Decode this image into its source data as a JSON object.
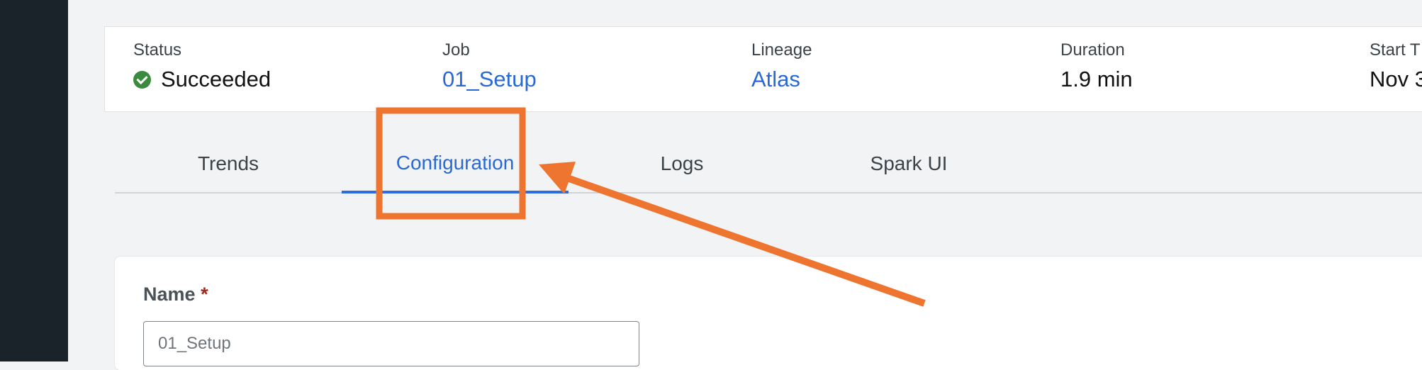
{
  "summary": {
    "status": {
      "label": "Status",
      "value": "Succeeded"
    },
    "job": {
      "label": "Job",
      "value": "01_Setup"
    },
    "lineage": {
      "label": "Lineage",
      "value": "Atlas"
    },
    "duration": {
      "label": "Duration",
      "value": "1.9 min"
    },
    "start_time": {
      "label": "Start T",
      "value": "Nov 3"
    }
  },
  "tabs": [
    {
      "label": "Trends",
      "active": false
    },
    {
      "label": "Configuration",
      "active": true
    },
    {
      "label": "Logs",
      "active": false
    },
    {
      "label": "Spark UI",
      "active": false
    }
  ],
  "form": {
    "name_label": "Name",
    "required_mark": "*",
    "name_value": "01_Setup"
  },
  "colors": {
    "accent": "#2869d6",
    "success": "#3a8a3f",
    "annotation": "#ee7530",
    "required": "#a4271b"
  }
}
